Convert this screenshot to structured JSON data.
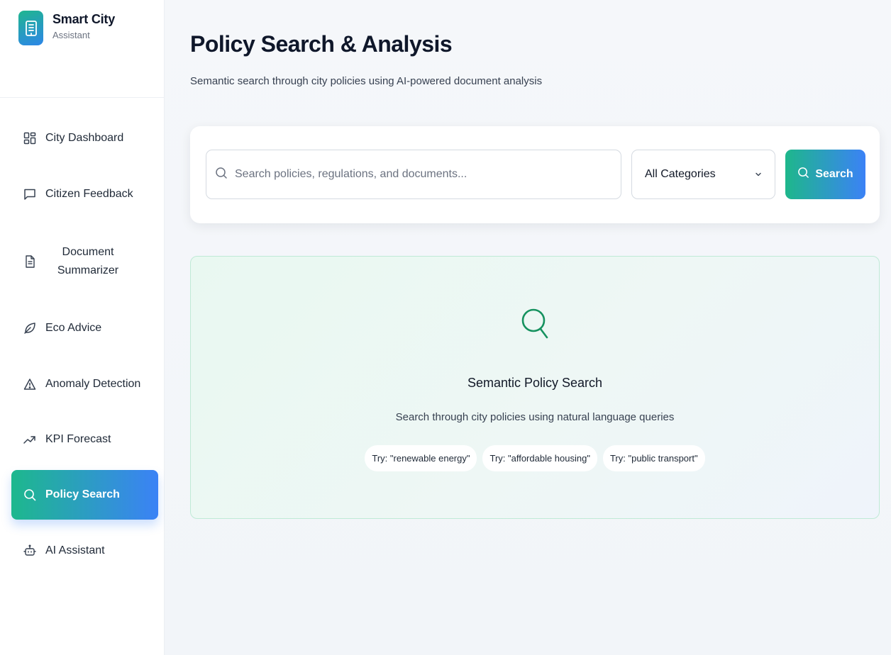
{
  "brand": {
    "title": "Smart City",
    "subtitle": "Assistant"
  },
  "nav": [
    {
      "label": "City Dashboard",
      "icon": "grid-icon"
    },
    {
      "label": "Citizen Feedback",
      "icon": "message-square-icon"
    },
    {
      "label": "Document Summarizer",
      "icon": "file-text-icon"
    },
    {
      "label": "Eco Advice",
      "icon": "leaf-icon"
    },
    {
      "label": "Anomaly Detection",
      "icon": "alert-triangle-icon"
    },
    {
      "label": "KPI Forecast",
      "icon": "trending-up-icon"
    },
    {
      "label": "Policy Search",
      "icon": "search-icon",
      "active": true
    },
    {
      "label": "AI Assistant",
      "icon": "bot-icon"
    }
  ],
  "page": {
    "title": "Policy Search & Analysis",
    "subtitle": "Semantic search through city policies using AI-powered document analysis"
  },
  "search": {
    "placeholder": "Search policies, regulations, and documents...",
    "value": "",
    "category_selected": "All Categories",
    "button_label": "Search"
  },
  "empty_state": {
    "title": "Semantic Policy Search",
    "subtitle": "Search through city policies using natural language queries",
    "suggestions": [
      "Try: \"renewable energy\"",
      "Try: \"affordable housing\"",
      "Try: \"public transport\""
    ]
  },
  "colors": {
    "accent_green": "#1eb78b",
    "accent_blue": "#3b82f6",
    "empty_icon": "#16925f"
  }
}
